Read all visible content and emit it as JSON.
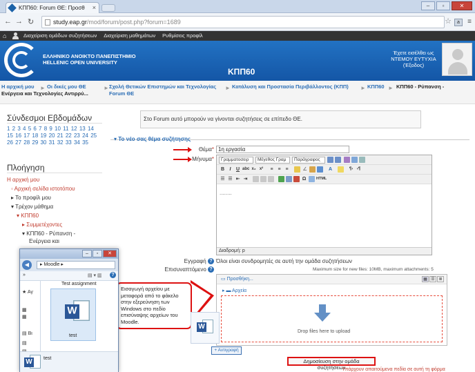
{
  "browser": {
    "tab_title": "ΚΠΠ60: Forum ΘΕ: Προσθ",
    "tab_close": "×",
    "url_host": "study.eap.gr",
    "url_path": "/mod/forum/post.php?forum=1689",
    "window_buttons": [
      "–",
      "▫",
      "✕"
    ]
  },
  "moodle_nav": {
    "items": [
      "Διαχείριση ομάδων συζητήσεων",
      "Διαχείριση μαθημάτων",
      "Ρυθμίσεις προφίλ"
    ]
  },
  "header": {
    "university_line1": "ΕΛΛΗΝΙΚΟ ΑΝΟΙΚΤΟ ΠΑΝΕΠΙΣΤΗΜΙΟ",
    "university_line2": "HELLENIC OPEN UNIVERSITY",
    "course": "ΚΠΠ60",
    "login_line1": "Έχετε εισέλθει ως",
    "login_name": "ΝΤΕΜΟΥ ΕΥΤΥΧΙΑ",
    "logout": "(Έξοδος)"
  },
  "breadcrumb": {
    "home_line1": "Η αρχική μου",
    "home_line2": "Ενέργεια και Τεχνολογίες Αντιρρύ...",
    "item1_line1": "Οι δικές μου ΘΕ",
    "item2": "Σχολή Θετικών Επιστημών και Τεχνολογίας",
    "item3": "Κατάλυση και Προστασία Περιβάλλοντος (ΚΠΠ)",
    "item4": "ΚΠΠ60",
    "item5_line1": "ΚΠΠ60 - Ρύπανση -",
    "item6": "Forum ΘΕ"
  },
  "sidebar": {
    "weeks_title": "Σύνδεσμοι Εβδομάδων",
    "weeks": "1 2 3 4 5 6 7 8 9 10 11 12 13 14 15 16 17 18 19 20 21 22 23 24 25 26 27 28 29 30 31 32 33 34 35",
    "nav_title": "Πλοήγηση",
    "nav": [
      "Η αρχική μου",
      "Αρχική σελίδα ιστοτόπου",
      "Το προφίλ μου",
      "Τρέχον μάθημα",
      "ΚΠΠ60",
      "Συμμετέχοντες",
      "ΚΠΠ60 - Ρύπανση -",
      "Ενέργεια και"
    ]
  },
  "form": {
    "info": "Στο Forum αυτό μπορούν να γίνονται συζητήσεις σε επίπεδο ΘΕ.",
    "section": "Το νέο σας θέμα συζήτησης",
    "subject_label": "Θέμα",
    "subject_value": "1η εργασία",
    "message_label": "Μήνυμα",
    "required_star": "*",
    "dd_font": "Γραμματοσειρ",
    "dd_size": "Μέγεθος Γραμ",
    "dd_para": "Παράγραφος",
    "editor_text": "........",
    "editor_path": "Διαδρομή: p",
    "subscription_label": "Εγγραφή",
    "subscription_value": "Όλοι είναι συνδρομητές σε αυτή την ομάδα συζητήσεων",
    "attachment_label": "Επισυναπτόμενο",
    "max_size": "Maximum size for new files: 10MB, maximum attachments: 5",
    "add": "Προσθήκη...",
    "folder": "Αρχεία",
    "drop_text": "Drop files here to upload",
    "copy_btn": "Αντιγραφή",
    "post_btn": "Δημοσίευση στην ομάδα συζητήσεων",
    "required_note": "Υπάρχουν απαιτούμενα πεδία σε αυτή τη φόρμα"
  },
  "callout": {
    "text": "Εισαγωγή αρχείου με μεταφορά από το φάκελο στην εξερεύνηση των Windows στο πεδίο επισύναψης αρχείων του Moodle."
  },
  "explorer": {
    "path": "Moodle",
    "file_label": "Test assignment",
    "file_name": "test",
    "status_name": "test",
    "nav_items": [
      "Αγ",
      "Βι"
    ]
  }
}
